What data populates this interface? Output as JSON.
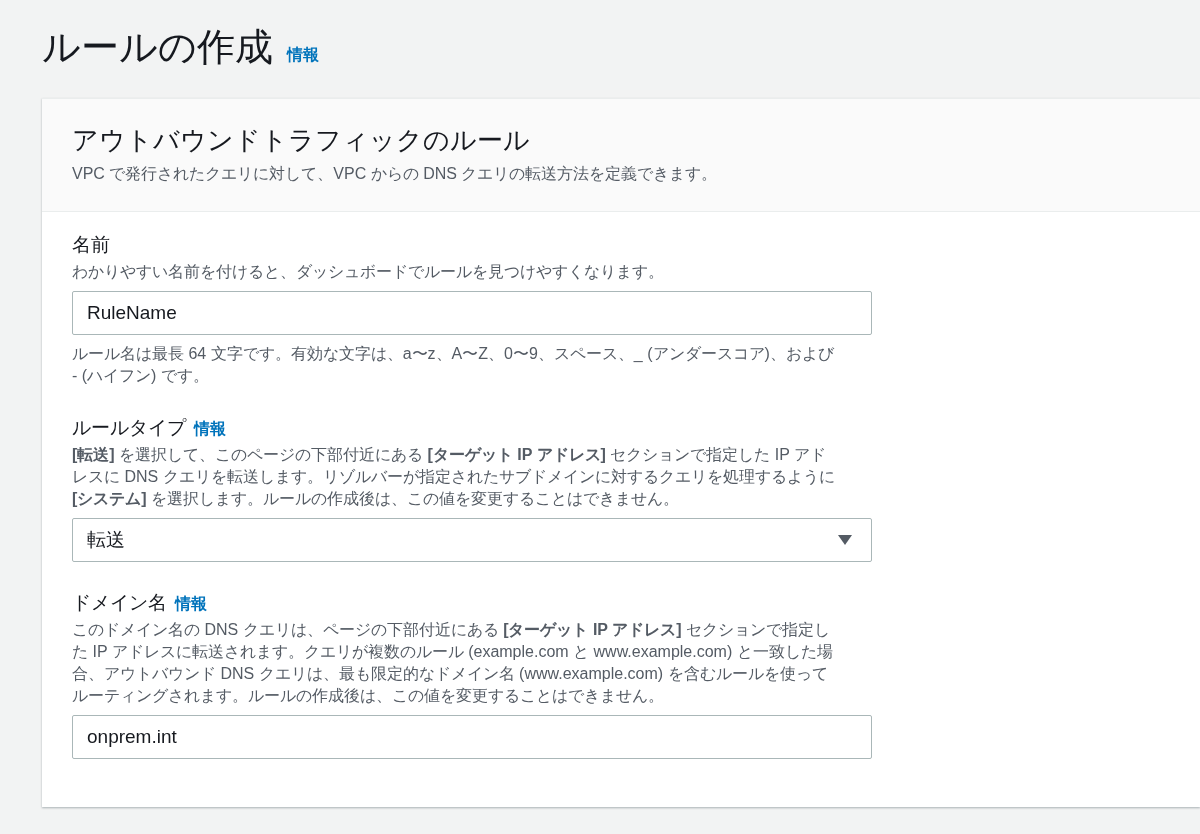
{
  "page": {
    "title": "ルールの作成",
    "info_link": "情報"
  },
  "card": {
    "title": "アウトバウンドトラフィックのルール",
    "description": "VPC で発行されたクエリに対して、VPC からの DNS クエリの転送方法を定義できます。",
    "fields": [
      {
        "kind": "text",
        "label": "名前",
        "description": "わかりやすい名前を付けると、ダッシュボードでルールを見つけやすくなります。",
        "value": "RuleName",
        "constraint": "ルール名は最長 64 文字です。有効な文字は、a〜z、A〜Z、0〜9、スペース、_ (アンダースコア)、および - (ハイフン) です。"
      },
      {
        "kind": "select",
        "label": "ルールタイプ",
        "info_link": "情報",
        "description": "**[転送]** を選択して、このページの下部付近にある **[ターゲット IP アドレス]** セクションで指定した IP アドレスに DNS クエリを転送します。リゾルバーが指定されたサブドメインに対するクエリを処理するように **[システム]** を選択します。ルールの作成後は、この値を変更することはできません。",
        "value": "転送"
      },
      {
        "kind": "text",
        "label": "ドメイン名",
        "info_link": "情報",
        "description": "このドメイン名の DNS クエリは、ページの下部付近にある **[ターゲット IP アドレス]** セクションで指定した IP アドレスに転送されます。クエリが複数のルール (example.com と www.example.com) と一致した場合、アウトバウンド DNS クエリは、最も限定的なドメイン名 (www.example.com) を含むルールを使ってルーティングされます。ルールの作成後は、この値を変更することはできません。",
        "value": "onprem.int"
      }
    ]
  }
}
